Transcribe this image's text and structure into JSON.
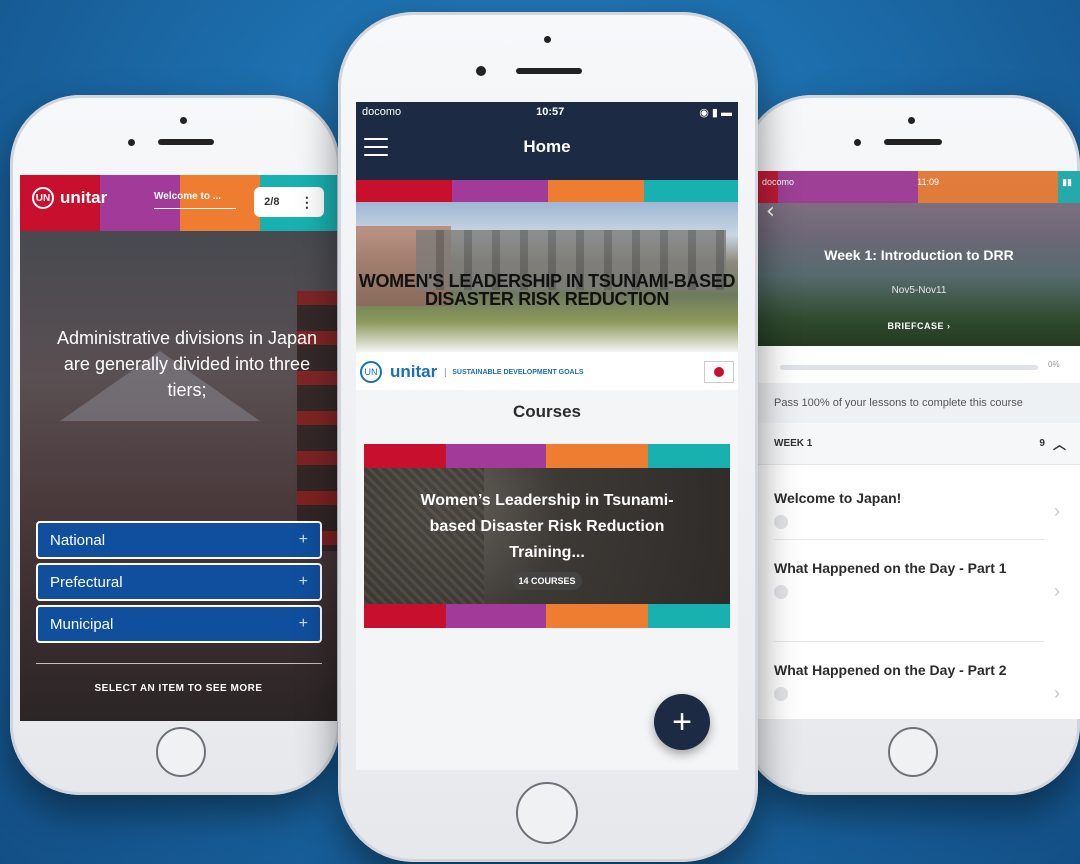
{
  "left_phone": {
    "logo_text": "unitar",
    "header_title": "Welcome to ...",
    "page_counter": "2/8",
    "more_icon": "vertical-dots-icon",
    "headline": "Administrative divisions in Japan are generally divided into three tiers;",
    "items": [
      {
        "label": "National",
        "icon": "plus-icon"
      },
      {
        "label": "Prefectural",
        "icon": "plus-icon"
      },
      {
        "label": "Municipal",
        "icon": "plus-icon"
      }
    ],
    "footer_hint": "SELECT AN ITEM TO SEE MORE"
  },
  "center_phone": {
    "status": {
      "carrier": "docomo",
      "time": "10:57"
    },
    "title": "Home",
    "banner_text": "WOMEN'S LEADERSHIP IN TSUNAMI-BASED DISASTER RISK REDUCTION",
    "logo_text": "unitar",
    "sdg_text": "SUSTAINABLE DEVELOPMENT GOALS",
    "courses_heading": "Courses",
    "course_card": {
      "title": "Women’s Leadership in Tsunami-based Disaster Risk Reduction Training...",
      "count": "14 COURSES"
    },
    "fab_label": "+"
  },
  "right_phone": {
    "status": {
      "carrier": "docomo",
      "time": "11:09"
    },
    "week_title": "Week 1: Introduction to DRR",
    "dates": "Nov5-Nov11",
    "briefcase_label": "BRIEFCASE ›",
    "progress_fraction": 0.0,
    "progress_label": "0%",
    "pass_notice": "Pass 100% of your lessons to complete this course",
    "week_header": {
      "label": "WEEK 1",
      "count": "9"
    },
    "lessons": [
      {
        "title": "Welcome to Japan!"
      },
      {
        "title": "What Happened on the Day - Part 1"
      },
      {
        "title": "What Happened on the Day - Part 2"
      }
    ]
  },
  "brand_colors": {
    "red": "#c8102e",
    "purple": "#a23a99",
    "orange": "#ee7d31",
    "teal": "#19b1b0",
    "navy": "#1c2a44",
    "blue": "#0f4f9e"
  }
}
